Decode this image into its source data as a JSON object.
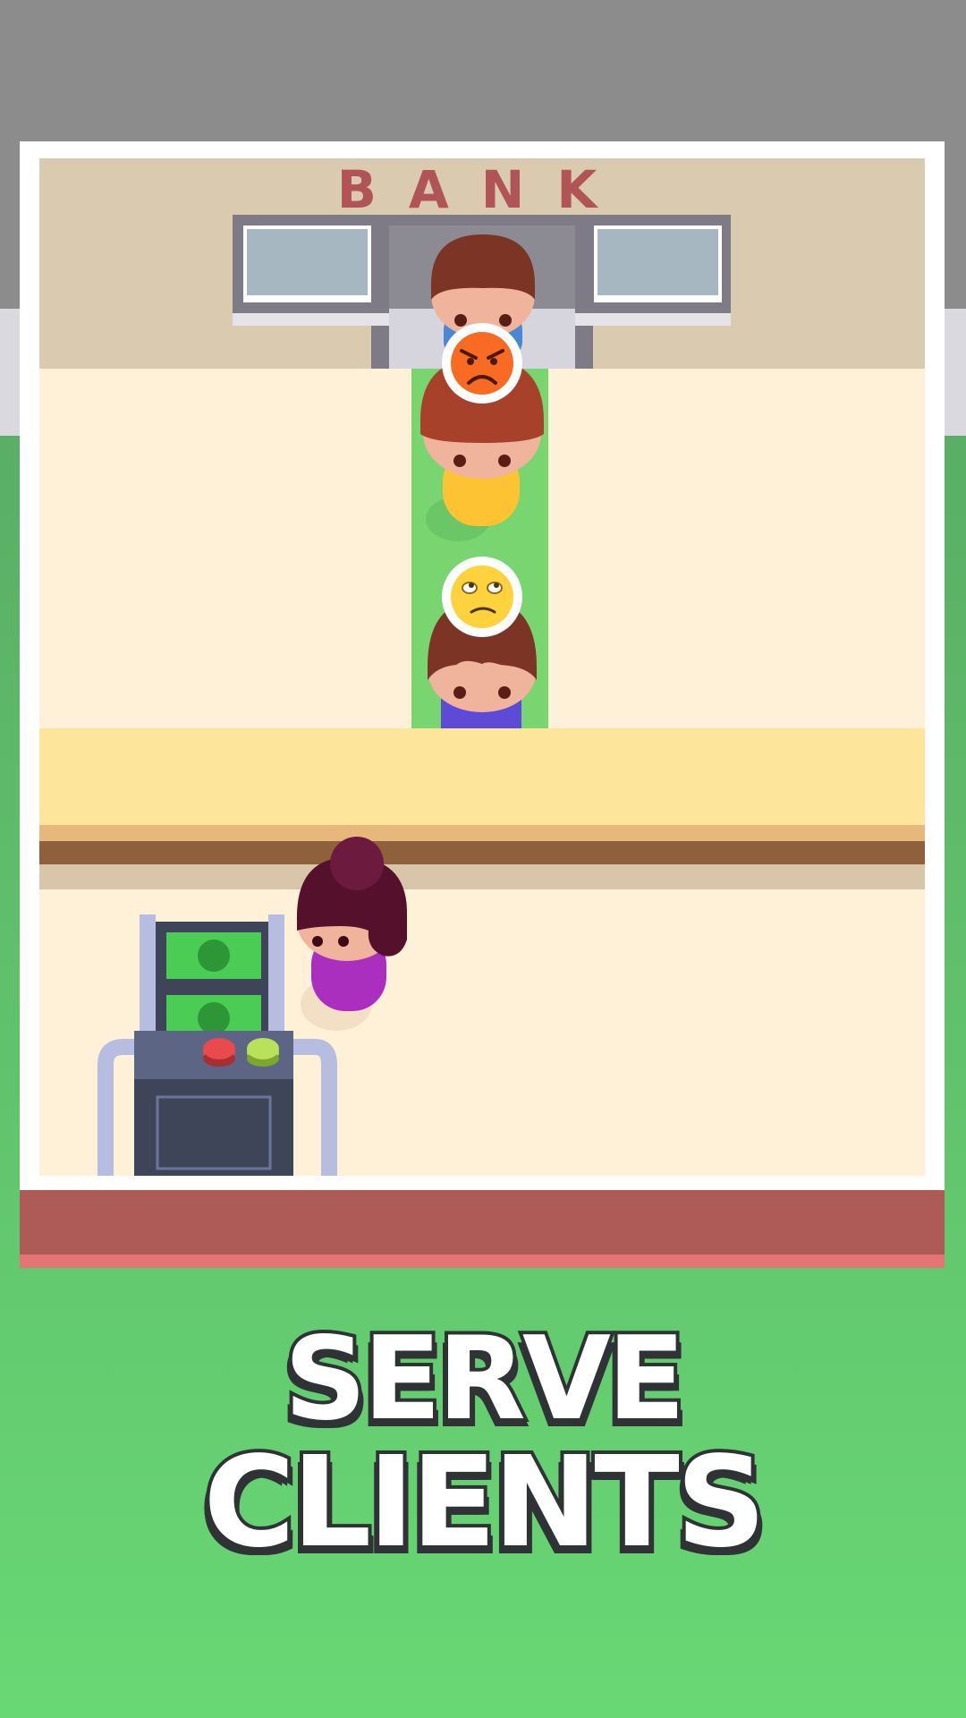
{
  "sign": {
    "text": "BANK"
  },
  "headline": {
    "line1": "SERVE",
    "line2": "CLIENTS"
  },
  "queue": [
    {
      "position": "teller",
      "mood": null,
      "hair": "#7c3425",
      "shirt": "#4b88d4"
    },
    {
      "position": "first-in-line",
      "mood": "angry",
      "hair": "#a8412a",
      "shirt": "#fdc332"
    },
    {
      "position": "second-in-line",
      "mood": "annoyed",
      "hair": "#7c3425",
      "shirt": "#5b4bd6"
    }
  ],
  "player": {
    "hair": "#55102c",
    "shirt": "#aa2fbe"
  },
  "cash_machine": {
    "bills": 2,
    "buttons": [
      "red",
      "green"
    ]
  },
  "colors": {
    "sky": "#8c8c8c",
    "grass": "#5db36b",
    "grass_light": "#68d874",
    "floor": "#fff0d8",
    "back_wall": "#dacbb0",
    "lane": "#78d570",
    "counter_top": "#fde59c",
    "counter_wood": "#8e613c",
    "wall_red": "#ae5a57",
    "sign_red": "#b05458"
  }
}
